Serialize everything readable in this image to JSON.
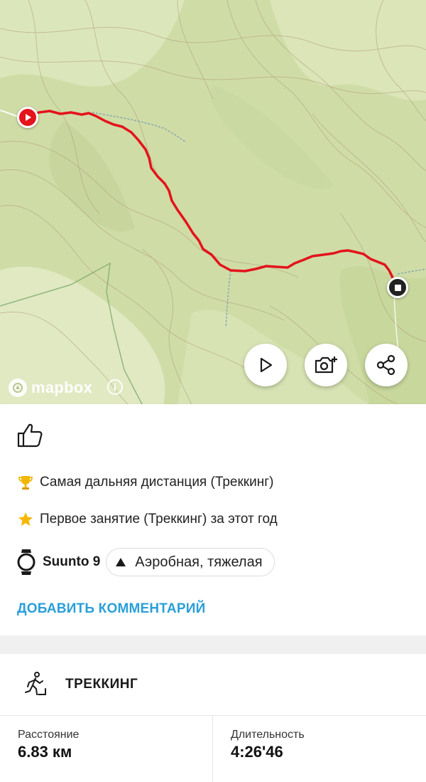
{
  "map": {
    "attribution": "mapbox",
    "info_glyph": "i",
    "route_color": "#e4131c",
    "buttons": {
      "play_icon": "play-icon",
      "photo_icon": "camera-add-icon",
      "share_icon": "share-icon"
    }
  },
  "card": {
    "like_icon": "thumbs-up-icon",
    "achievements": [
      {
        "icon": "trophy-icon",
        "text": "Самая дальняя дистанция (Треккинг)"
      },
      {
        "icon": "star-icon",
        "text": "Первое занятие (Треккинг) за этот год"
      }
    ],
    "device": {
      "icon": "watch-icon",
      "name": "Suunto 9"
    },
    "training_effect": {
      "icon": "triangle-up-icon",
      "label": "Аэробная, тяжелая"
    },
    "add_comment": "ДОБАВИТЬ КОММЕНТАРИЙ"
  },
  "activity": {
    "icon": "hiking-icon",
    "title": "ТРЕККИНГ",
    "stats": [
      {
        "label": "Расстояние",
        "value": "6.83 км"
      },
      {
        "label": "Длительность",
        "value": "4:26'46"
      }
    ]
  },
  "colors": {
    "accent": "#2a9fd8",
    "map_base": "#cfdca6",
    "route": "#e4131c"
  }
}
